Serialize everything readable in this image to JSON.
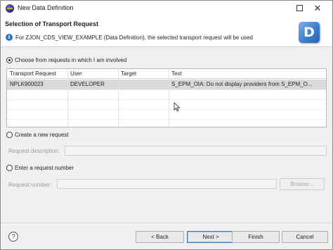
{
  "window": {
    "title": "New Data Definition",
    "maximize_icon": "maximize-icon",
    "close_glyph": "✕"
  },
  "banner": {
    "title": "Selection of Transport Request",
    "message": "For ZJON_CDS_VIEW_EXAMPLE (Data Definition), the selected transport request will be used",
    "logo_letter": "D",
    "info_glyph": "i"
  },
  "options": {
    "involved_label": "Choose from requests in which I am involved",
    "create_label": "Create a new request",
    "enter_label": "Enter a request number",
    "selected": "involved"
  },
  "table": {
    "columns": [
      "Transport Request",
      "User",
      "Target",
      "Text"
    ],
    "rows": [
      [
        "NPLK900023",
        "DEVELOPER",
        "",
        "S_EPM_OIA: Do not display providers from S_EPM_O..."
      ]
    ]
  },
  "fields": {
    "request_description_label": "Request description:",
    "request_description_value": "",
    "request_number_label": "Request number:",
    "request_number_value": "",
    "browse_label": "Browse..."
  },
  "footer": {
    "help_glyph": "?",
    "back_label": "< Back",
    "next_label": "Next >",
    "finish_label": "Finish",
    "cancel_label": "Cancel"
  }
}
